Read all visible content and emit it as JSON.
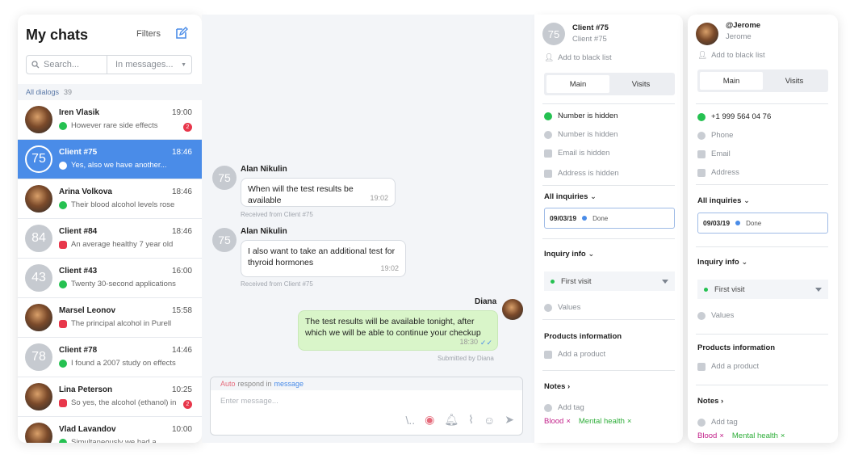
{
  "left": {
    "title": "My chats",
    "filters_label": "Filters",
    "search_placeholder": "Search...",
    "search_scope": "In messages...",
    "all_dialogs_label": "All dialogs",
    "all_dialogs_count": "39",
    "chats": [
      {
        "name": "Iren Vlasik",
        "time": "19:00",
        "preview": "However rare side effects",
        "channel": "wa",
        "avatar": "photo",
        "badge": "2"
      },
      {
        "name": "Client #75",
        "time": "18:46",
        "preview": "Yes, also we have another...",
        "channel": "wa",
        "avatar": "75",
        "active": true
      },
      {
        "name": "Arina Volkova",
        "time": "18:46",
        "preview": "Their blood alcohol levels rose",
        "channel": "wa",
        "avatar": "photo"
      },
      {
        "name": "Client #84",
        "time": "18:46",
        "preview": "An average healthy 7 year old",
        "channel": "ig",
        "avatar": "84"
      },
      {
        "name": "Client #43",
        "time": "16:00",
        "preview": "Twenty 30-second applications",
        "channel": "wa",
        "avatar": "43"
      },
      {
        "name": "Marsel Leonov",
        "time": "15:58",
        "preview": "The principal alcohol in Purell",
        "channel": "ig",
        "avatar": "photo"
      },
      {
        "name": "Client #78",
        "time": "14:46",
        "preview": "I found a 2007 study on effects",
        "channel": "wa",
        "avatar": "78"
      },
      {
        "name": "Lina Peterson",
        "time": "10:25",
        "preview": "So yes, the alcohol (ethanol) in",
        "channel": "ig",
        "avatar": "photo",
        "badge": "2"
      },
      {
        "name": "Vlad Lavandov",
        "time": "10:00",
        "preview": "Simultaneously we had a",
        "channel": "wa",
        "avatar": "photo"
      }
    ]
  },
  "middle": {
    "messages": [
      {
        "avatar": "75",
        "name": "Alan Nikulin",
        "text": "When will the test results be available",
        "time": "19:02",
        "note": "Received from Client #75"
      },
      {
        "avatar": "75",
        "name": "Alan Nikulin",
        "text": "I also want to take an additional test for thyroid hormones",
        "time": "19:02",
        "note": "Received from Client #75"
      },
      {
        "avatar": "photo",
        "name": "Diana",
        "text": "The test results will be available tonight, after which we will be able to continue your checkup",
        "time": "18:30",
        "note": "Submitted by Diana"
      }
    ],
    "composer": {
      "auto": "Auto",
      "respond": "respond in",
      "message": "message",
      "placeholder": "Enter message..."
    }
  },
  "panel1": {
    "avatar": "75",
    "name": "Client #75",
    "sub": "Client #75",
    "blacklist": "Add to black list",
    "tab_main": "Main",
    "tab_visits": "Visits",
    "contacts": [
      "Number is hidden",
      "Number is hidden",
      "Email is hidden",
      "Address is hidden"
    ],
    "all_inquiries": "All inquiries",
    "inq_date": "09/03/19",
    "inq_status": "Done",
    "inquiry_info": "Inquiry info",
    "first_visit": "First visit",
    "values": "Values",
    "products": "Products information",
    "add_product": "Add a product",
    "notes": "Notes",
    "add_tag": "Add tag",
    "tags": [
      "Blood",
      "Mental health"
    ]
  },
  "panel2": {
    "name": "@Jerome",
    "sub": "Jerome",
    "blacklist": "Add to black list",
    "tab_main": "Main",
    "tab_visits": "Visits",
    "phone_wa": "+1 999 564 04 76",
    "phone": "Phone",
    "email": "Email",
    "address": "Address",
    "all_inquiries": "All inquiries",
    "inq_date": "09/03/19",
    "inq_status": "Done",
    "inquiry_info": "Inquiry info",
    "first_visit": "First visit",
    "values": "Values",
    "products": "Products information",
    "add_product": "Add a product",
    "notes": "Notes",
    "add_tag": "Add tag",
    "tags": [
      "Blood",
      "Mental health"
    ]
  },
  "colors": {
    "accent": "#4a8ce8",
    "whatsapp": "#25c151",
    "instagram": "#e8374b",
    "outgoing": "#d9f5c9"
  }
}
